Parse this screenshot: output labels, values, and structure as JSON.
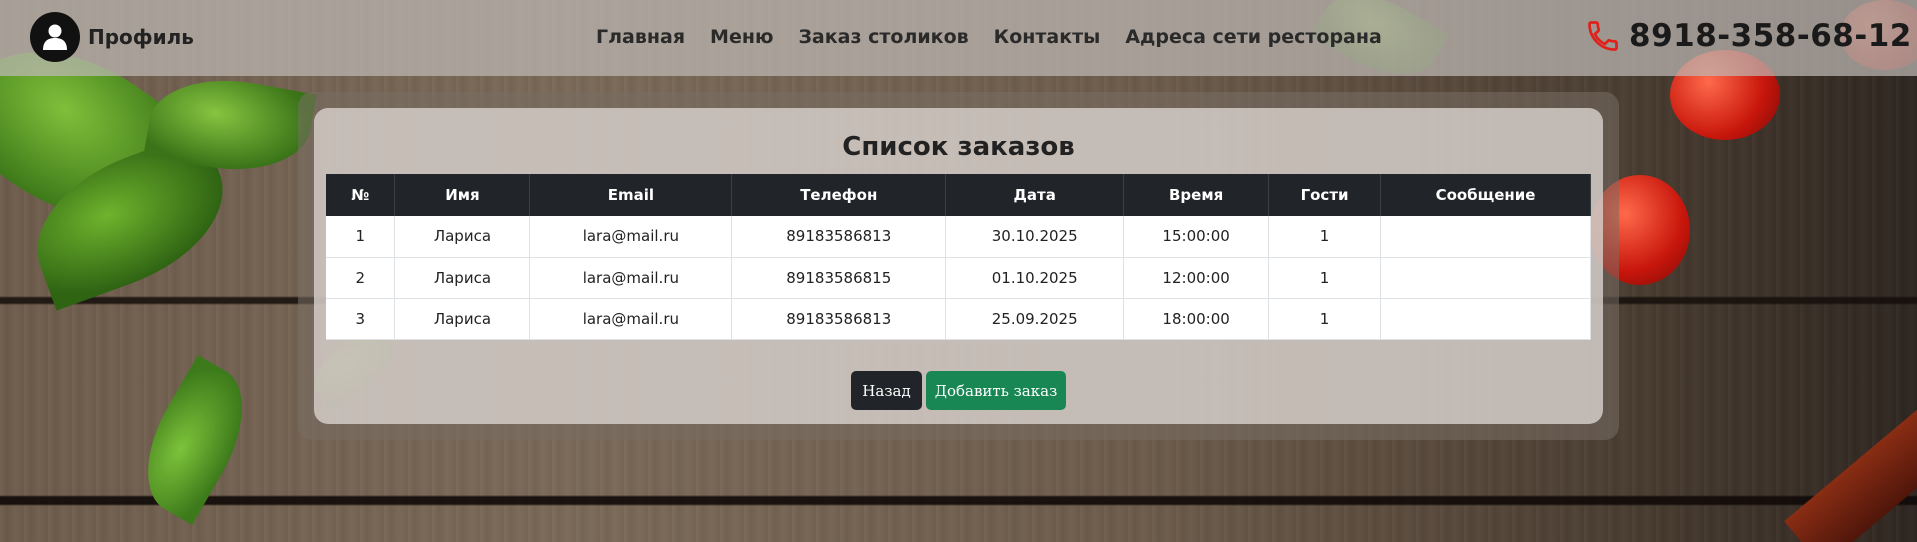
{
  "header": {
    "profile_label": "Профиль",
    "nav": [
      "Главная",
      "Меню",
      "Заказ столиков",
      "Контакты",
      "Адреса сети ресторана"
    ],
    "phone": "8918-358-68-12"
  },
  "main": {
    "title": "Список заказов",
    "columns": [
      "№",
      "Имя",
      "Email",
      "Телефон",
      "Дата",
      "Время",
      "Гости",
      "Сообщение"
    ],
    "rows": [
      [
        "1",
        "Лариса",
        "lara@mail.ru",
        "89183586813",
        "30.10.2025",
        "15:00:00",
        "1",
        ""
      ],
      [
        "2",
        "Лариса",
        "lara@mail.ru",
        "89183586815",
        "01.10.2025",
        "12:00:00",
        "1",
        ""
      ],
      [
        "3",
        "Лариса",
        "lara@mail.ru",
        "89183586813",
        "25.09.2025",
        "18:00:00",
        "1",
        ""
      ]
    ],
    "back_label": "Назад",
    "add_label": "Добавить заказ"
  },
  "colors": {
    "header_bg": "#bdb8b2",
    "table_head": "#212529",
    "add_button": "#198754",
    "phone_icon": "#e0211b"
  }
}
